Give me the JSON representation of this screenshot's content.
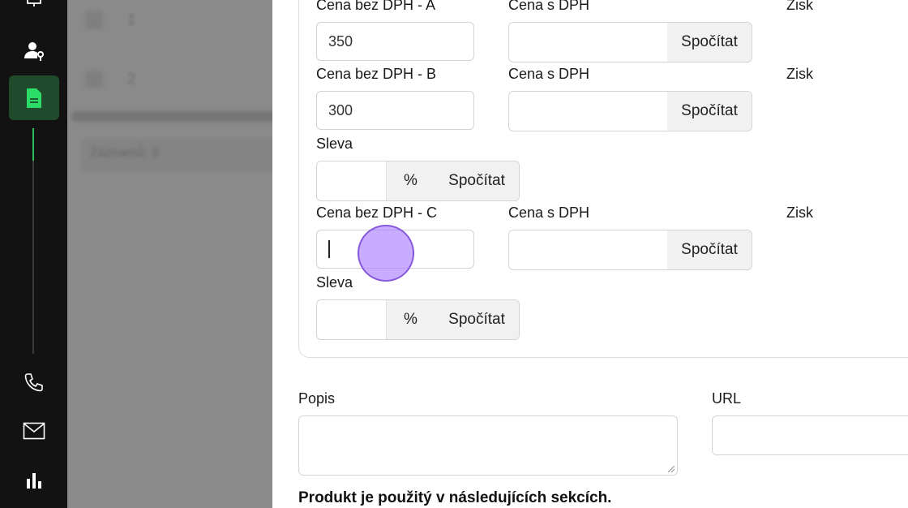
{
  "sidebar": {
    "icons": [
      "bell-icon",
      "user-key-icon",
      "document-icon",
      "phone-icon",
      "mail-icon",
      "bar-chart-icon"
    ],
    "accent_color": "#2bbf5b",
    "active_bg": "#1f4a2c"
  },
  "backdrop": {
    "rows": [
      "1",
      "2"
    ],
    "footer_text": "Záznamů: 3"
  },
  "pricing": {
    "a": {
      "label": "Cena bez DPH - A",
      "value": "350",
      "vat_label": "Cena s DPH",
      "calc_label": "Spočítat",
      "profit_label": "Zisk"
    },
    "b": {
      "label": "Cena bez DPH - B",
      "value": "300",
      "vat_label": "Cena s DPH",
      "calc_label": "Spočítat",
      "profit_label": "Zisk"
    },
    "b_discount": {
      "label": "Sleva",
      "unit": "%",
      "calc_label": "Spočítat"
    },
    "c": {
      "label": "Cena bez DPH - C",
      "value": "",
      "vat_label": "Cena s DPH",
      "calc_label": "Spočítat",
      "profit_label": "Zisk"
    },
    "c_discount": {
      "label": "Sleva",
      "unit": "%",
      "calc_label": "Spočítat"
    }
  },
  "description": {
    "label": "Popis",
    "value": ""
  },
  "url": {
    "label": "URL",
    "value": ""
  },
  "sections_heading": "Produkt je použitý v následujících sekcích."
}
